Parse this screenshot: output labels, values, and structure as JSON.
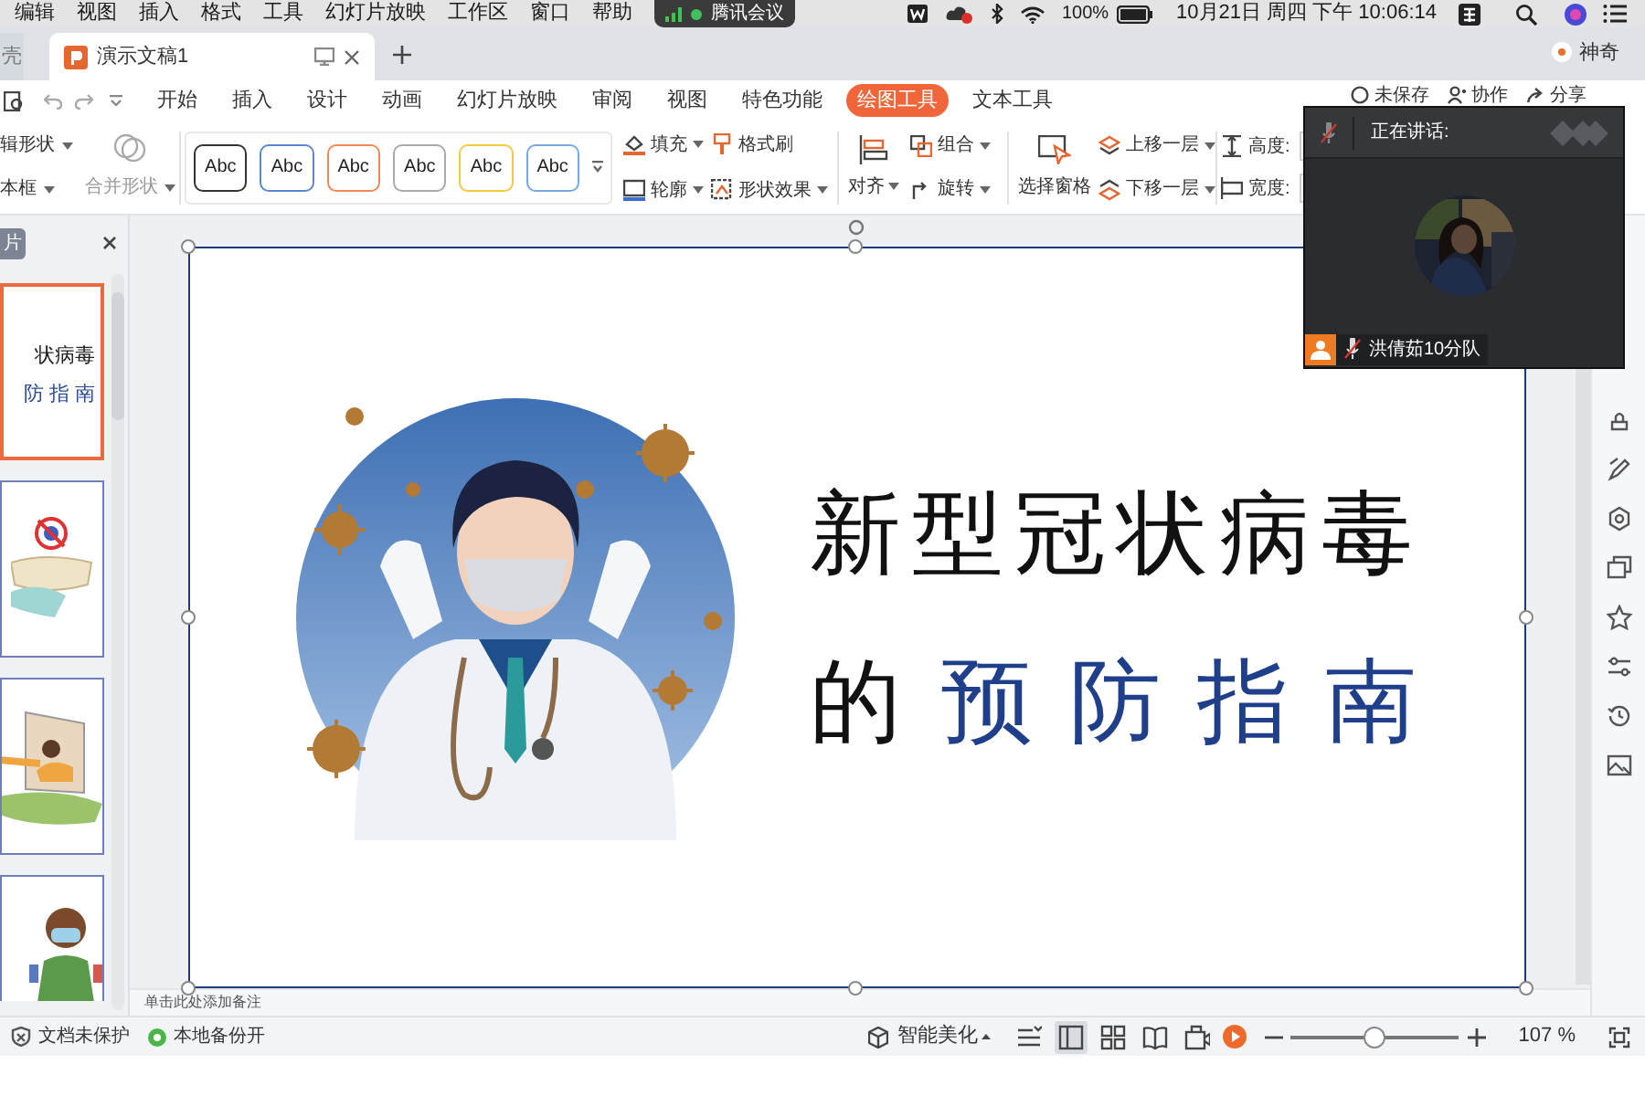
{
  "menubar": {
    "menus": [
      "编辑",
      "视图",
      "插入",
      "格式",
      "工具",
      "幻灯片放映",
      "工作区",
      "窗口",
      "帮助"
    ],
    "meeting_app": "腾讯会议",
    "battery": "100%",
    "clock": "10月21日 周四 下午 10:06:14"
  },
  "document_tabs": [
    {
      "label": "壳",
      "selected": false
    },
    {
      "label": "演示文稿1",
      "selected": true
    }
  ],
  "account": "神奇",
  "ribbon_tabs": [
    {
      "label": "开始",
      "selected": false
    },
    {
      "label": "插入",
      "selected": false
    },
    {
      "label": "设计",
      "selected": false
    },
    {
      "label": "动画",
      "selected": false
    },
    {
      "label": "幻灯片放映",
      "selected": false
    },
    {
      "label": "审阅",
      "selected": false
    },
    {
      "label": "视图",
      "selected": false
    },
    {
      "label": "特色功能",
      "selected": false
    },
    {
      "label": "绘图工具",
      "selected": true
    },
    {
      "label": "文本工具",
      "selected": false
    }
  ],
  "header_actions": [
    "未保存",
    "协作",
    "分享"
  ],
  "toolbar": {
    "shape_buttons": [
      "辑形状",
      "本框"
    ],
    "merge_shapes": {
      "label": "合并形状",
      "disabled": true
    },
    "style_presets": [
      {
        "label": "Abc",
        "color": "#333333"
      },
      {
        "label": "Abc",
        "color": "#5b86d6"
      },
      {
        "label": "Abc",
        "color": "#f08a50"
      },
      {
        "label": "Abc",
        "color": "#aaaaaa"
      },
      {
        "label": "Abc",
        "color": "#f5c842"
      },
      {
        "label": "Abc",
        "color": "#7aa7e0"
      }
    ],
    "format_buttons": [
      "填充",
      "格式刷",
      "轮廓",
      "形状效果"
    ],
    "arrange_buttons": [
      "对齐",
      "组合",
      "旋转",
      "选择窗格",
      "上移一层",
      "下移一层"
    ],
    "size_fields": [
      "高度:",
      "宽度:"
    ]
  },
  "slides_panel": {
    "tab": "片",
    "thumbnails": [
      {
        "selected": true,
        "line1": "状病毒",
        "line2": "防 指 南"
      },
      {
        "selected": false
      },
      {
        "selected": false
      },
      {
        "selected": false
      }
    ]
  },
  "slide": {
    "title": "新型冠状病毒",
    "subtitle_prefix": "的",
    "subtitle_highlight": "预防指南"
  },
  "notes_placeholder": "单击此处添加备注",
  "meeting": {
    "heading": "正在讲话:",
    "participant": "洪倩茹10分队",
    "mic_muted": true
  },
  "status_bar": {
    "left": [
      "文档未保护",
      "本地备份开"
    ],
    "beautify": "智能美化",
    "view_modes": [
      {
        "selected": false
      },
      {
        "selected": true
      },
      {
        "selected": false
      },
      {
        "selected": false
      },
      {
        "selected": false
      }
    ],
    "zoom": {
      "level": 0.5,
      "reading": "107 %"
    }
  }
}
